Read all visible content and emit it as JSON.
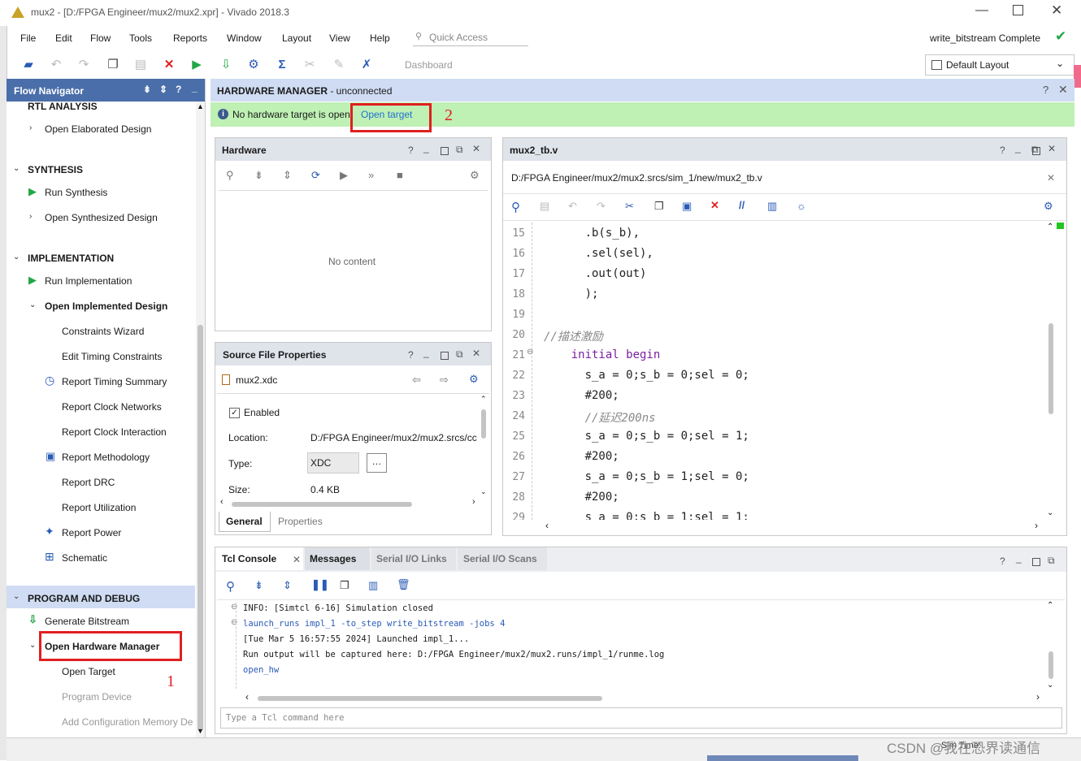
{
  "window": {
    "title": "mux2 - [D:/FPGA Engineer/mux2/mux2.xpr] - Vivado 2018.3"
  },
  "menu": [
    "File",
    "Edit",
    "Flow",
    "Tools",
    "Reports",
    "Window",
    "Layout",
    "View",
    "Help"
  ],
  "quick_access": {
    "placeholder": "Quick Access"
  },
  "status": {
    "text": "write_bitstream Complete"
  },
  "toolbar": {
    "dashboard": "Dashboard",
    "layout": "Default Layout"
  },
  "flow_nav": {
    "title": "Flow Navigator",
    "rtl_analysis": "RTL ANALYSIS",
    "open_elaborated": "Open Elaborated Design",
    "synthesis": "SYNTHESIS",
    "run_synthesis": "Run Synthesis",
    "open_synthesized": "Open Synthesized Design",
    "implementation": "IMPLEMENTATION",
    "run_implementation": "Run Implementation",
    "open_implemented": "Open Implemented Design",
    "constraints_wizard": "Constraints Wizard",
    "edit_timing": "Edit Timing Constraints",
    "report_timing": "Report Timing Summary",
    "report_clock_networks": "Report Clock Networks",
    "report_clock_interaction": "Report Clock Interaction",
    "report_methodology": "Report Methodology",
    "report_drc": "Report DRC",
    "report_utilization": "Report Utilization",
    "report_power": "Report Power",
    "schematic": "Schematic",
    "program_debug": "PROGRAM AND DEBUG",
    "generate_bitstream": "Generate Bitstream",
    "open_hw_manager": "Open Hardware Manager",
    "open_target": "Open Target",
    "program_device": "Program Device",
    "add_config_memory": "Add Configuration Memory De"
  },
  "hw_manager": {
    "title_bold": "HARDWARE MANAGER",
    "title_rest": " - unconnected",
    "banner_text": "No hardware target is open",
    "banner_link": "Open target"
  },
  "annotations": {
    "one": "1",
    "two": "2"
  },
  "hardware_panel": {
    "title": "Hardware",
    "empty": "No content"
  },
  "sfp": {
    "title": "Source File Properties",
    "file": "mux2.xdc",
    "enabled": "Enabled",
    "location_label": "Location:",
    "location_value": "D:/FPGA Engineer/mux2/mux2.srcs/cc",
    "type_label": "Type:",
    "type_value": "XDC",
    "size_label": "Size:",
    "size_value": "0.4 KB",
    "tab_general": "General",
    "tab_properties": "Properties"
  },
  "editor": {
    "title": "mux2_tb.v",
    "path": "D:/FPGA Engineer/mux2/mux2.srcs/sim_1/new/mux2_tb.v",
    "lines": [
      {
        "n": "15",
        "pre": "      .b(s_b),",
        "kw": "",
        "post": "",
        "cm": ""
      },
      {
        "n": "16",
        "pre": "      .sel(sel),",
        "kw": "",
        "post": "",
        "cm": ""
      },
      {
        "n": "17",
        "pre": "      .out(out)",
        "kw": "",
        "post": "",
        "cm": ""
      },
      {
        "n": "18",
        "pre": "      );",
        "kw": "",
        "post": "",
        "cm": ""
      },
      {
        "n": "19",
        "pre": "",
        "kw": "",
        "post": "",
        "cm": ""
      },
      {
        "n": "20",
        "pre": "",
        "kw": "",
        "post": "",
        "cm": "//描述激励"
      },
      {
        "n": "21",
        "pre": "    ",
        "kw": "initial begin",
        "post": "",
        "cm": ""
      },
      {
        "n": "22",
        "pre": "      s_a = 0;s_b = 0;sel = 0;",
        "kw": "",
        "post": "",
        "cm": ""
      },
      {
        "n": "23",
        "pre": "      #200;",
        "kw": "",
        "post": "",
        "cm": ""
      },
      {
        "n": "24",
        "pre": "      ",
        "kw": "",
        "post": "",
        "cm": "//延迟200ns"
      },
      {
        "n": "25",
        "pre": "      s_a = 0;s_b = 0;sel = 1;",
        "kw": "",
        "post": "",
        "cm": ""
      },
      {
        "n": "26",
        "pre": "      #200;",
        "kw": "",
        "post": "",
        "cm": ""
      },
      {
        "n": "27",
        "pre": "      s_a = 0;s_b = 1;sel = 0;",
        "kw": "",
        "post": "",
        "cm": ""
      },
      {
        "n": "28",
        "pre": "      #200;",
        "kw": "",
        "post": "",
        "cm": ""
      },
      {
        "n": "29",
        "pre": "      s_a = 0;s_b = 1;sel = 1;",
        "kw": "",
        "post": "",
        "cm": ""
      }
    ]
  },
  "console": {
    "tabs": [
      "Tcl Console",
      "Messages",
      "Serial I/O Links",
      "Serial I/O Scans"
    ],
    "lines": [
      "INFO: [Simtcl 6-16] Simulation closed",
      "launch_runs impl_1 -to_step write_bitstream -jobs 4",
      "[Tue Mar  5 16:57:55 2024] Launched impl_1...",
      "Run output will be captured here: D:/FPGA Engineer/mux2/mux2.runs/impl_1/runme.log",
      "open_hw"
    ],
    "placeholder": "Type a Tcl command here"
  },
  "footer": {
    "sim_time": "Sim Time:",
    "watermark": "CSDN @我在恐界读通信"
  }
}
